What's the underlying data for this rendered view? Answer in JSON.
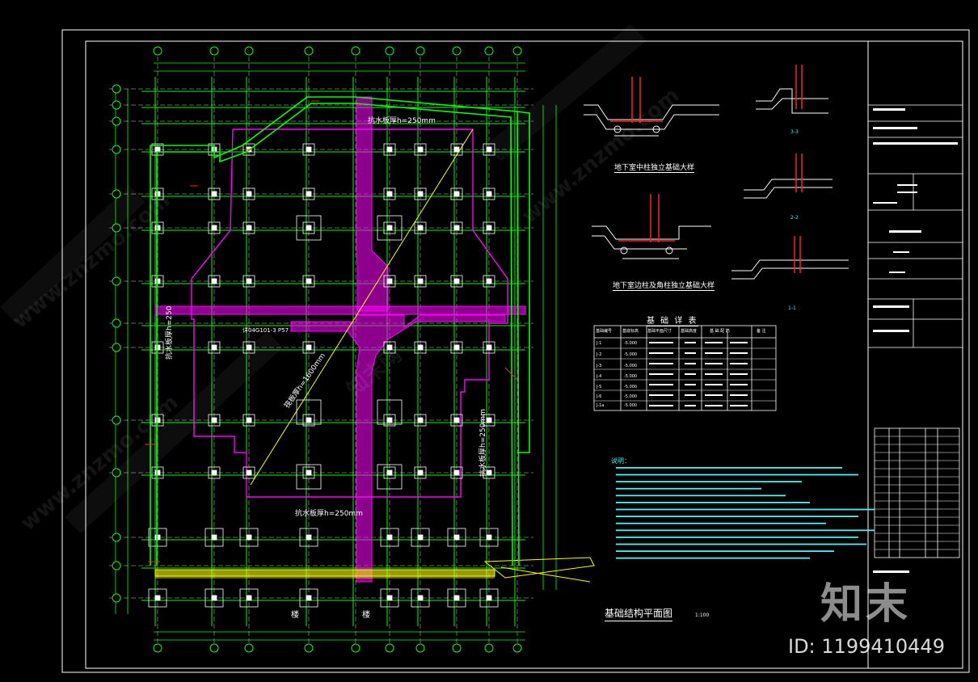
{
  "drawing": {
    "plan_title": "基础结构平面图",
    "plan_scale": "1:100",
    "detail_titles": [
      "地下室中柱独立基础大样",
      "地下室边柱及角柱独立基础大样"
    ],
    "table_title": "基 础 详 表",
    "table_headers": [
      "基础编号",
      "基底标高",
      "基础平面尺寸",
      "基础高度",
      "基 础 配 筋",
      "备 注"
    ],
    "table_rows": [
      [
        "J-1",
        "-5.000",
        "",
        "",
        "",
        ""
      ],
      [
        "J-2",
        "-5.000",
        "",
        "",
        "",
        ""
      ],
      [
        "J-3",
        "-5.000",
        "",
        "",
        "",
        ""
      ],
      [
        "J-4",
        "-5.000",
        "",
        "",
        "",
        ""
      ],
      [
        "J-5",
        "-5.000",
        "",
        "",
        "",
        ""
      ],
      [
        "J-6",
        "-5.000",
        "",
        "",
        "",
        ""
      ],
      [
        "J-1a",
        "-5.000",
        "",
        "",
        "",
        ""
      ]
    ],
    "annotations": {
      "slab_top": "抗水板厚h=250mm",
      "slab_bottom": "抗水板厚h=250mm",
      "slab_left": "抗水板厚h=250",
      "slab_right": "抗水板厚h=250mm",
      "slab_diag": "筏板厚h=1600mm",
      "ref": "详04G101-3 P57",
      "stair1": "楼",
      "stair2": "楼"
    },
    "notes_title": "说明：",
    "section_marks": [
      "3-3",
      "2-2",
      "1-1"
    ]
  },
  "watermark": {
    "brand": "知末",
    "id": "ID: 1199410449",
    "site": "www.znzmo.com",
    "cn": "知末网"
  },
  "colors": {
    "background": "#000000",
    "grid": "#00ff00",
    "axis": "#ffffff",
    "magenta": "#ff00ff",
    "yellow": "#ffff00",
    "red": "#ff2020",
    "cyan": "#4ef0f0"
  }
}
